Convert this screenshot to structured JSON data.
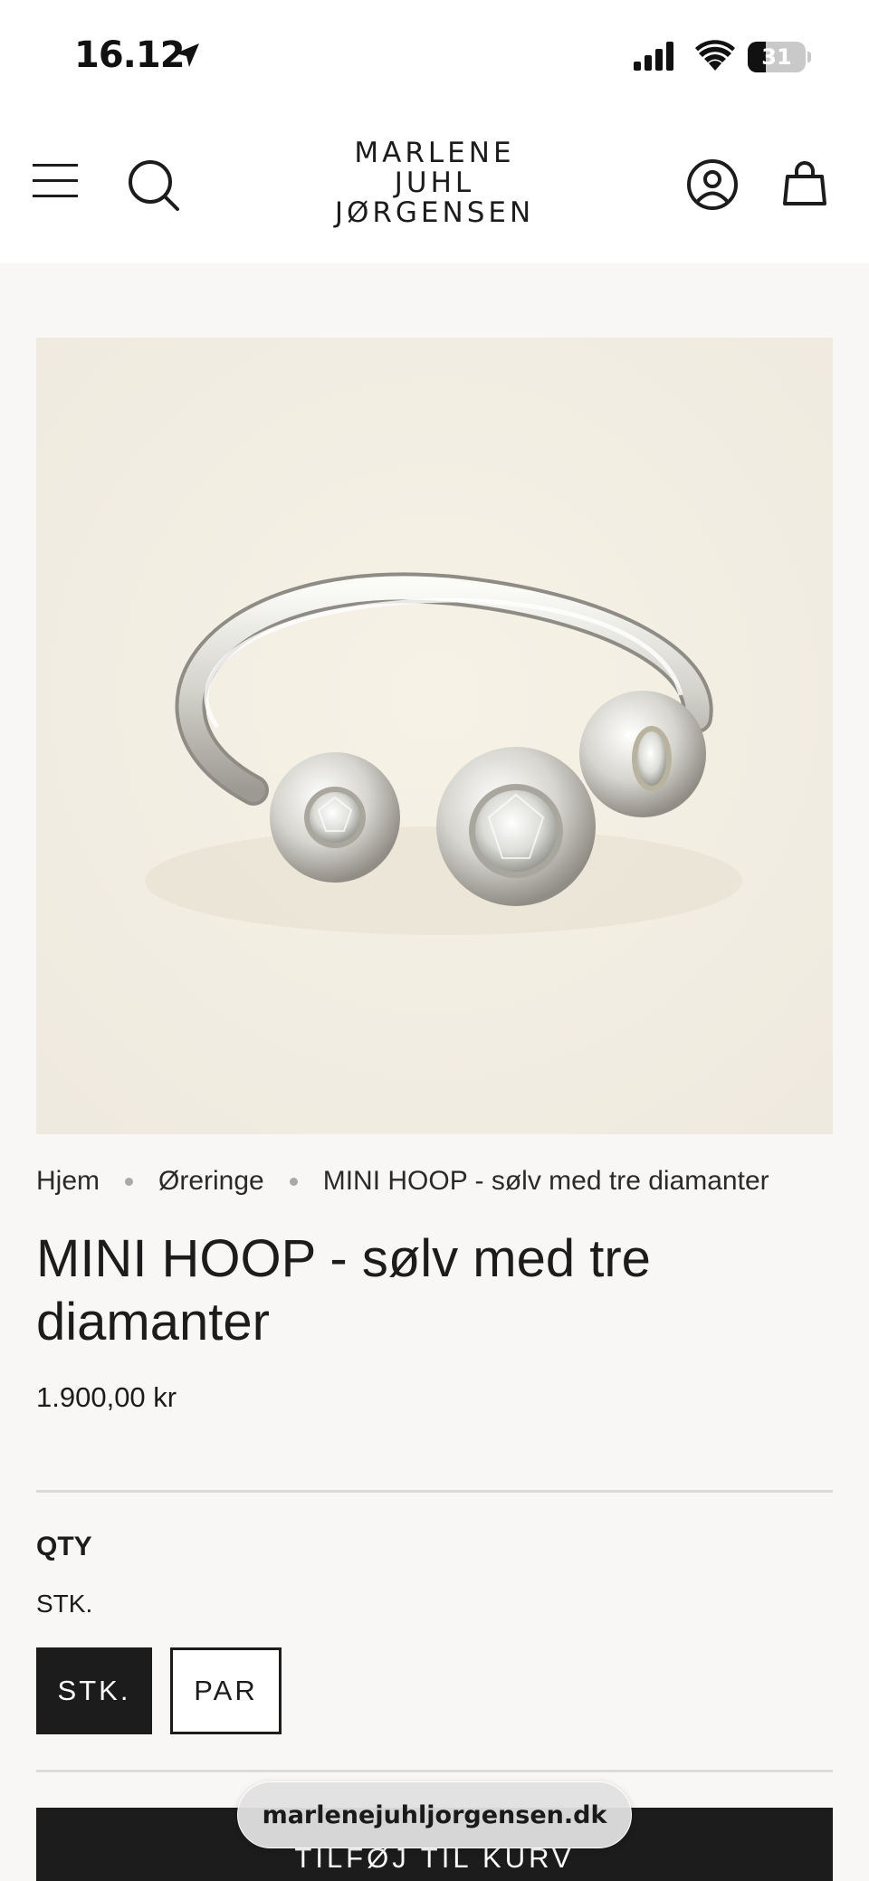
{
  "status_bar": {
    "time": "16.12",
    "battery": "31",
    "battery_level": 0.31
  },
  "header": {
    "logo_lines": [
      "MARLENE",
      "JUHL",
      "JØRGENSEN"
    ],
    "icons": [
      "menu-icon",
      "search-icon",
      "account-icon",
      "cart-icon"
    ]
  },
  "product_image": {
    "description_icon": "ring-image"
  },
  "breadcrumb": {
    "items": [
      "Hjem",
      "Øreringe",
      "MINI HOOP - sølv med tre diamanter"
    ]
  },
  "product": {
    "title": "MINI HOOP - sølv med tre diamanter",
    "price": "1.900,00 kr"
  },
  "options": {
    "label": "QTY",
    "selected": "STK.",
    "values": [
      "STK.",
      "PAR"
    ]
  },
  "cta": {
    "add_to_cart": "TILFØJ TIL KURV"
  },
  "browser": {
    "url": "marlenejuhljorgensen.dk"
  },
  "colors": {
    "background": "#f8f7f5",
    "header_bg": "#ffffff",
    "primary_dark": "#1c1c1c",
    "image_bg": "#f1ede4"
  }
}
